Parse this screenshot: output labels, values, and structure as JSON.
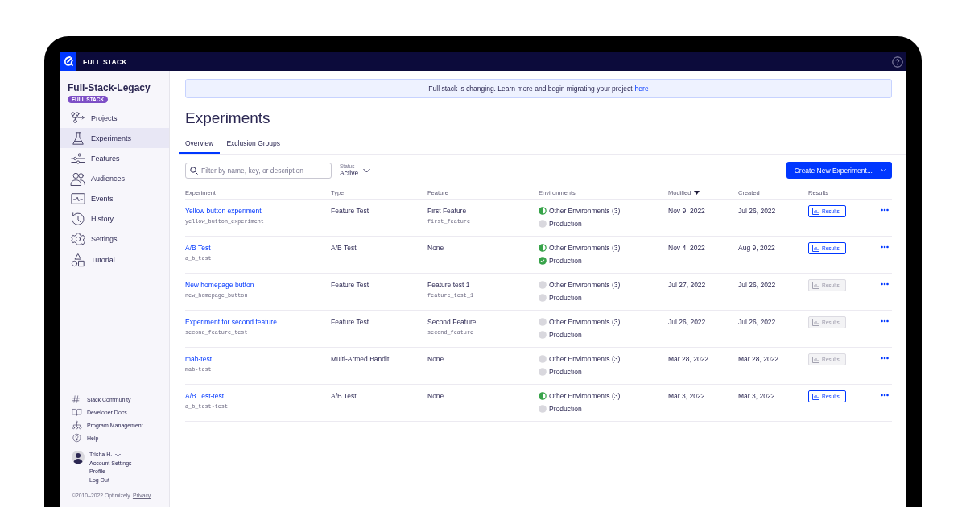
{
  "header": {
    "brand": "FULL STACK"
  },
  "sidebar": {
    "project": "Full-Stack-Legacy",
    "badge": "FULL STACK",
    "nav": [
      {
        "label": "Projects",
        "kind": "projects",
        "selected": false
      },
      {
        "label": "Experiments",
        "kind": "flask",
        "selected": true
      },
      {
        "label": "Features",
        "kind": "sliders",
        "selected": false
      },
      {
        "label": "Audiences",
        "kind": "people",
        "selected": false
      },
      {
        "label": "Events",
        "kind": "monitor",
        "selected": false
      },
      {
        "label": "History",
        "kind": "history",
        "selected": false
      },
      {
        "label": "Settings",
        "kind": "gear",
        "selected": false
      },
      {
        "label": "Tutorial",
        "kind": "shapes",
        "selected": false
      }
    ],
    "links": [
      {
        "label": "Slack Community",
        "kind": "hash"
      },
      {
        "label": "Developer Docs",
        "kind": "book"
      },
      {
        "label": "Program Management",
        "kind": "hierarchy"
      },
      {
        "label": "Help",
        "kind": "help"
      }
    ],
    "user": {
      "name": "Trisha H.",
      "menu": [
        "Account Settings",
        "Profile",
        "Log Out"
      ]
    },
    "footer": {
      "copyright": "©2010–2022 Optimizely.",
      "link": "Privacy"
    }
  },
  "banner": {
    "text": "Full stack is changing. Learn more and begin migrating your project",
    "link": "here"
  },
  "page_title": "Experiments",
  "tabs": [
    {
      "label": "Overview",
      "selected": true
    },
    {
      "label": "Exclusion Groups",
      "selected": false
    }
  ],
  "search": {
    "placeholder": "Filter by name, key, or description"
  },
  "status_filter": {
    "label": "Status",
    "value": "Active"
  },
  "create_button": "Create New Experiment...",
  "table": {
    "columns": [
      {
        "label": "Experiment",
        "sorted": false
      },
      {
        "label": "Type",
        "sorted": false
      },
      {
        "label": "Feature",
        "sorted": false
      },
      {
        "label": "Environments",
        "sorted": false
      },
      {
        "label": "Modified",
        "sorted": true
      },
      {
        "label": "Created",
        "sorted": false
      },
      {
        "label": "Results",
        "sorted": false
      }
    ],
    "rows": [
      {
        "name": "Yellow button experiment",
        "key": "yellow_button_experiment",
        "type": "Feature Test",
        "feature": "First Feature",
        "feature_key": "first_feature",
        "environments": [
          {
            "label": "Other Environments (3)",
            "kind": "partial"
          },
          {
            "label": "Production",
            "kind": "off"
          }
        ],
        "modified": "Nov 9, 2022",
        "created": "Jul 26, 2022",
        "results": {
          "label": "Results",
          "disabled": false
        }
      },
      {
        "name": "A/B Test",
        "key": "a_b_test",
        "type": "A/B Test",
        "feature": "None",
        "environments": [
          {
            "label": "Other Environments (3)",
            "kind": "partial"
          },
          {
            "label": "Production",
            "kind": "on"
          }
        ],
        "modified": "Nov 4, 2022",
        "created": "Aug 9, 2022",
        "results": {
          "label": "Results",
          "disabled": false
        }
      },
      {
        "name": "New homepage button",
        "key": "new_homepage_button",
        "type": "Feature Test",
        "feature": "Feature test 1",
        "feature_key": "feature_test_1",
        "environments": [
          {
            "label": "Other Environments (3)",
            "kind": "off"
          },
          {
            "label": "Production",
            "kind": "off"
          }
        ],
        "modified": "Jul 27, 2022",
        "created": "Jul 26, 2022",
        "results": {
          "label": "Results",
          "disabled": true
        }
      },
      {
        "name": "Experiment for second feature",
        "key": "second_feature_test",
        "type": "Feature Test",
        "feature": "Second Feature",
        "feature_key": "second_feature",
        "environments": [
          {
            "label": "Other Environments (3)",
            "kind": "off"
          },
          {
            "label": "Production",
            "kind": "off"
          }
        ],
        "modified": "Jul 26, 2022",
        "created": "Jul 26, 2022",
        "results": {
          "label": "Results",
          "disabled": true
        }
      },
      {
        "name": "mab-test",
        "key": "mab-test",
        "type": "Multi-Armed Bandit",
        "feature": "None",
        "environments": [
          {
            "label": "Other Environments (3)",
            "kind": "off"
          },
          {
            "label": "Production",
            "kind": "off"
          }
        ],
        "modified": "Mar 28, 2022",
        "created": "Mar 28, 2022",
        "results": {
          "label": "Results",
          "disabled": true
        }
      },
      {
        "name": "A/B Test-test",
        "key": "a_b_test-test",
        "type": "A/B Test",
        "feature": "None",
        "environments": [
          {
            "label": "Other Environments (3)",
            "kind": "partial"
          },
          {
            "label": "Production",
            "kind": "off"
          }
        ],
        "modified": "Mar 3, 2022",
        "created": "Mar 3, 2022",
        "results": {
          "label": "Results",
          "disabled": false
        }
      }
    ]
  }
}
